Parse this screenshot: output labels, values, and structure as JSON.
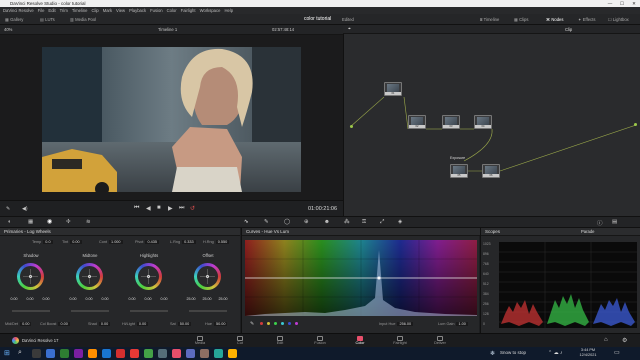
{
  "window": {
    "title": "DaVinci Resolve Studio - color tutorial",
    "minimize": "—",
    "maximize": "☐",
    "close": "✕"
  },
  "menu": [
    "DaVinci Resolve",
    "File",
    "Edit",
    "Trim",
    "Timeline",
    "Clip",
    "Mark",
    "View",
    "Playback",
    "Fusion",
    "Color",
    "Fairlight",
    "Workspace",
    "Help"
  ],
  "toolbar": {
    "gallery": "Gallery",
    "luts": "LUTs",
    "media_pool": "Media Pool",
    "project_title": "color tutorial",
    "edited": "Edited",
    "timeline": "Timeline",
    "clips": "Clips",
    "nodes": "Nodes",
    "effects": "Effects",
    "lightbox": "Lightbox"
  },
  "viewer": {
    "zoom": "40%",
    "timeline_name": "Timeline 1",
    "header_timecode": "02:57:48:14",
    "timecode": "01:00:21:06"
  },
  "node_editor": {
    "mode": "Clip",
    "nodes": [
      {
        "id": "01",
        "label": "01"
      },
      {
        "id": "02",
        "label": "02"
      },
      {
        "id": "03",
        "label": "03"
      },
      {
        "id": "04",
        "label": "04"
      },
      {
        "id": "05",
        "label": "05"
      },
      {
        "id": "06",
        "label": "06"
      }
    ],
    "exposure_label": "Exposure"
  },
  "primaries": {
    "title": "Primaries - Log Wheels",
    "temp_label": "Temp",
    "temp": "0.0",
    "tint_label": "Tint",
    "tint": "0.00",
    "cont_label": "Cont",
    "cont": "1.000",
    "pivot_label": "Pivot",
    "pivot": "0.435",
    "ang_label": "L.Rng",
    "ang": "0.333",
    "hrng_label": "H.Rng",
    "hrng": "0.550",
    "wheels": [
      {
        "name": "Shadow",
        "values": [
          "0.00",
          "0.00",
          "0.00"
        ]
      },
      {
        "name": "Midtone",
        "values": [
          "0.00",
          "0.00",
          "0.00"
        ]
      },
      {
        "name": "Highlights",
        "values": [
          "0.00",
          "0.00",
          "0.00"
        ]
      },
      {
        "name": "Offset",
        "values": [
          "25.00",
          "25.00",
          "25.00"
        ]
      }
    ],
    "bottom": {
      "middetail_label": "Mid/Det",
      "middetail": "0.00",
      "colboost_label": "Col Boost",
      "colboost": "0.00",
      "shad_label": "Shad",
      "shad": "0.00",
      "hilight_label": "Hi/Light",
      "hilight": "0.00",
      "sat_label": "Sat",
      "sat": "50.00",
      "hue_label": "Hue",
      "hue": "50.00"
    }
  },
  "curves": {
    "title": "Curves - Hue Vs Lum",
    "input_hue_label": "Input Hue",
    "input_hue": "256.00",
    "lum_gain_label": "Lum Gain",
    "lum_gain": "1.00"
  },
  "scopes": {
    "title": "Scopes",
    "mode": "Parade",
    "scale": [
      "1023",
      "896",
      "768",
      "640",
      "512",
      "384",
      "256",
      "128",
      "0"
    ]
  },
  "pages": [
    {
      "label": "Media",
      "active": false
    },
    {
      "label": "Cut",
      "active": false
    },
    {
      "label": "Edit",
      "active": false
    },
    {
      "label": "Fusion",
      "active": false
    },
    {
      "label": "Color",
      "active": true
    },
    {
      "label": "Fairlight",
      "active": false
    },
    {
      "label": "Deliver",
      "active": false
    }
  ],
  "app_name": "DaVinci Resolve 17",
  "taskbar": {
    "snow": "Snow to stop",
    "time": "3:44 PM",
    "date": "12/4/2021"
  },
  "colors": {
    "accent": "#e84f6b",
    "bg": "#1d1e20",
    "panel": "#262729"
  }
}
